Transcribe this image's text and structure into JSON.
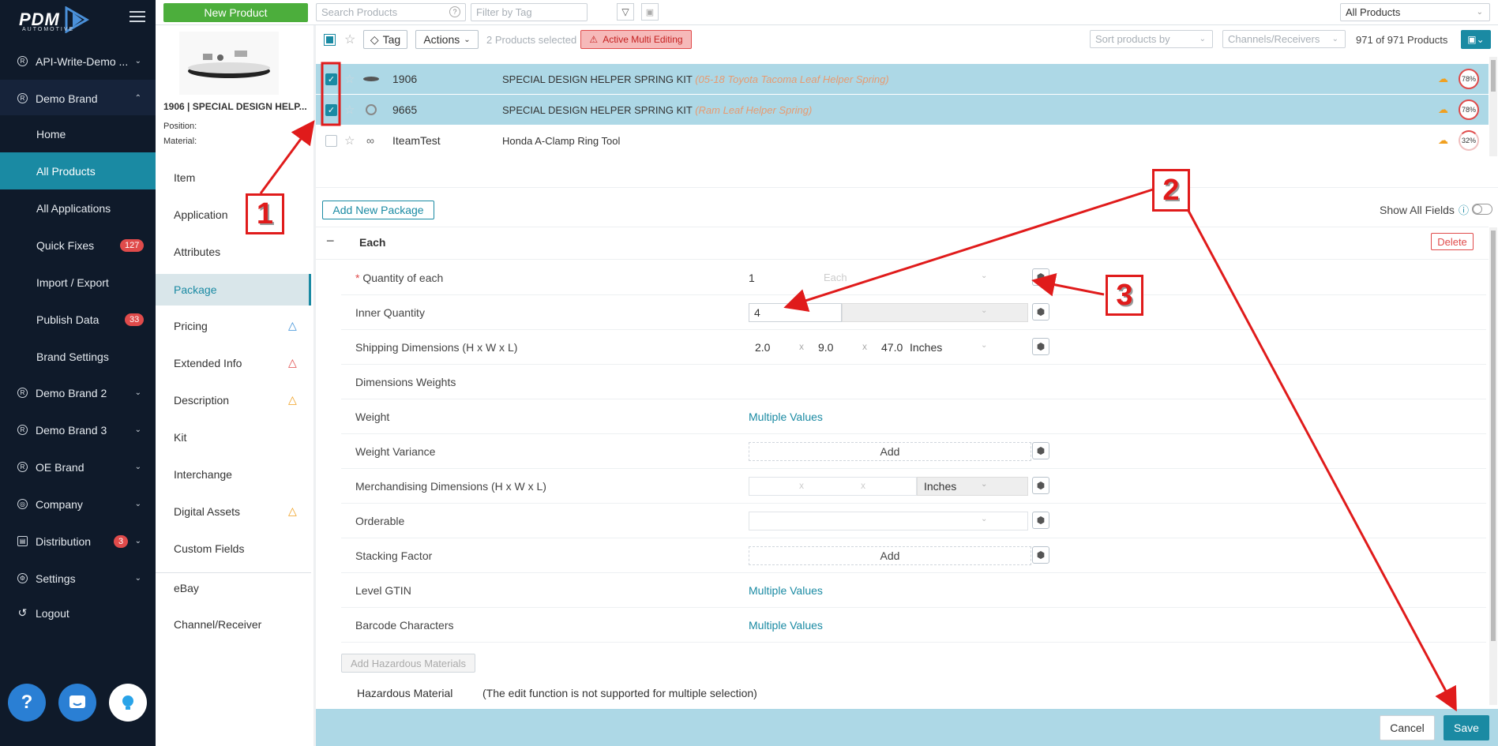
{
  "app": {
    "logo_main": "PDM",
    "logo_sub": "AUTOMOTIVE"
  },
  "sidebar": {
    "brands": [
      {
        "label": "API-Write-Demo ...",
        "icon": "registered-icon"
      },
      {
        "label": "Demo Brand",
        "icon": "registered-icon"
      },
      {
        "label": "Demo Brand 2",
        "icon": "registered-icon"
      },
      {
        "label": "Demo Brand 3",
        "icon": "registered-icon"
      },
      {
        "label": "OE Brand",
        "icon": "registered-icon"
      },
      {
        "label": "Company",
        "icon": "globe-icon"
      },
      {
        "label": "Distribution",
        "icon": "distribution-icon",
        "badge": "3"
      },
      {
        "label": "Settings",
        "icon": "gear-icon"
      },
      {
        "label": "Logout",
        "icon": "logout-icon"
      }
    ],
    "sub_items": [
      {
        "label": "Home"
      },
      {
        "label": "All Products"
      },
      {
        "label": "All Applications"
      },
      {
        "label": "Quick Fixes",
        "badge": "127"
      },
      {
        "label": "Import / Export"
      },
      {
        "label": "Publish Data",
        "badge": "33"
      },
      {
        "label": "Brand Settings"
      }
    ],
    "help_label": "?"
  },
  "topbar": {
    "new_product": "New Product",
    "search_placeholder": "Search Products",
    "filter_placeholder": "Filter by Tag",
    "scope_select": "All Products"
  },
  "product_panel": {
    "title": "1906 | SPECIAL DESIGN HELP...",
    "position_label": "Position:",
    "material_label": "Material:"
  },
  "left_menu": [
    {
      "label": "Item"
    },
    {
      "label": "Application"
    },
    {
      "label": "Attributes"
    },
    {
      "label": "Package"
    },
    {
      "label": "Pricing",
      "warn": "blue"
    },
    {
      "label": "Extended Info",
      "warn": "red"
    },
    {
      "label": "Description",
      "warn": "orange"
    },
    {
      "label": "Kit"
    },
    {
      "label": "Interchange"
    },
    {
      "label": "Digital Assets",
      "warn": "orange"
    },
    {
      "label": "Custom Fields"
    },
    {
      "label": "eBay"
    },
    {
      "label": "Channel/Receiver"
    }
  ],
  "list_toolbar": {
    "tag": "Tag",
    "actions": "Actions",
    "selected": "2 Products selected",
    "multi_edit": "Active Multi Editing",
    "sort": "Sort products by",
    "channels": "Channels/Receivers",
    "count": "971 of 971 Products"
  },
  "products": [
    {
      "part": "1906",
      "name": "SPECIAL DESIGN HELPER SPRING KIT",
      "sub": "(05-18 Toyota Tacoma Leaf Helper Spring)",
      "score": "78%",
      "selected": true
    },
    {
      "part": "9665",
      "name": "SPECIAL DESIGN HELPER SPRING KIT",
      "sub": "(Ram Leaf Helper Spring)",
      "score": "78%",
      "selected": true
    },
    {
      "part": "IteamTest",
      "name": "Honda A-Clamp Ring Tool",
      "sub": "",
      "score": "32%",
      "selected": false
    }
  ],
  "package": {
    "add_button": "Add New Package",
    "show_all_fields": "Show All Fields",
    "section_title": "Each",
    "delete": "Delete",
    "fields": {
      "qty_label": "Quantity of each",
      "qty_value": "1",
      "qty_unit": "Each",
      "inner_label": "Inner Quantity",
      "inner_value": "4",
      "ship_label": "Shipping Dimensions (H x W x L)",
      "ship_h": "2.0",
      "ship_w": "9.0",
      "ship_l": "47.0",
      "ship_unit": "Inches",
      "x": "x",
      "dimw_label": "Dimensions Weights",
      "weight_label": "Weight",
      "weight_value": "Multiple Values",
      "wvar_label": "Weight Variance",
      "add": "Add",
      "merch_label": "Merchandising Dimensions (H x W x L)",
      "merch_unit": "Inches",
      "orderable_label": "Orderable",
      "stacking_label": "Stacking Factor",
      "gtin_label": "Level GTIN",
      "gtin_value": "Multiple Values",
      "barcode_label": "Barcode Characters",
      "barcode_value": "Multiple Values",
      "add_hazmat": "Add Hazardous Materials",
      "hazmat_label": "Hazardous Material",
      "hazmat_note": "(The edit function is not supported for multiple selection)"
    }
  },
  "footer": {
    "cancel": "Cancel",
    "save": "Save"
  },
  "annotations": {
    "one": "1",
    "two": "2",
    "three": "3"
  },
  "colors": {
    "accent": "#1a8aa3",
    "sidebar": "#0f1a2a",
    "new_product": "#4cae3c",
    "selected_row": "#add8e6",
    "annotation": "#e01b1b"
  }
}
